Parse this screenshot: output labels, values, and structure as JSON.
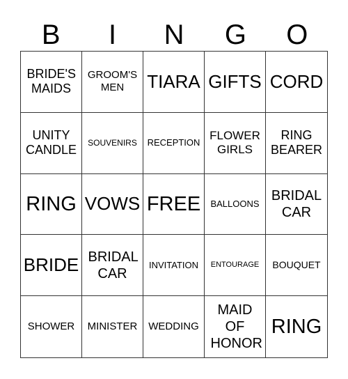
{
  "header": [
    "B",
    "I",
    "N",
    "G",
    "O"
  ],
  "cells": [
    [
      "BRIDE'S MAIDS",
      "GROOM'S MEN",
      "TIARA",
      "GIFTS",
      "CORD"
    ],
    [
      "UNITY CANDLE",
      "SOUVENIRS",
      "RECEPTION",
      "FLOWER GIRLS",
      "RING BEARER"
    ],
    [
      "RING",
      "VOWS",
      "FREE",
      "BALLOONS",
      "BRIDAL CAR"
    ],
    [
      "BRIDE",
      "BRIDAL CAR",
      "INVITATION",
      "ENTOURAGE",
      "BOUQUET"
    ],
    [
      "SHOWER",
      "MINISTER",
      "WEDDING",
      "MAID OF HONOR",
      "RING"
    ]
  ]
}
